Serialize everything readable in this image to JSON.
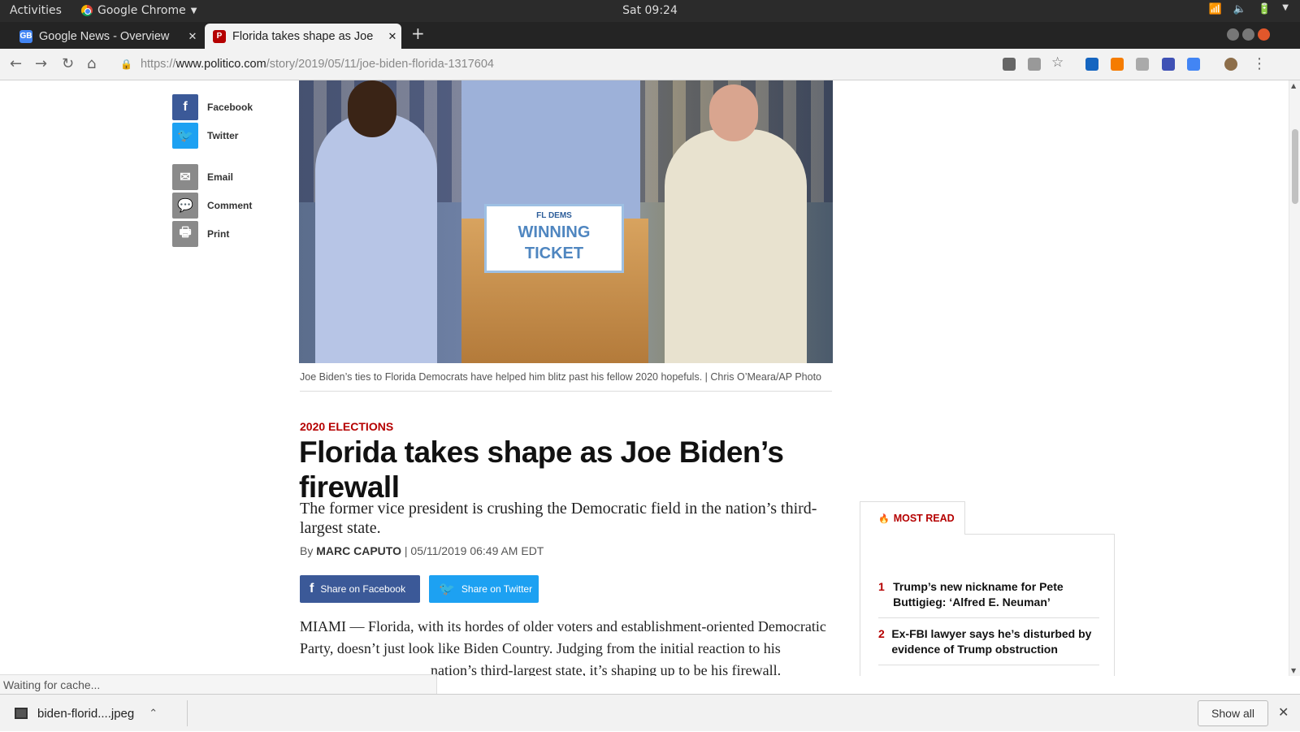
{
  "system_bar": {
    "activities": "Activities",
    "app_name": "Google Chrome",
    "clock": "Sat 09:24"
  },
  "tabs": [
    {
      "title": "Google News - Overview",
      "favicon_text": "GB",
      "favicon_color": "#4285f4"
    },
    {
      "title": "Florida takes shape as Joe",
      "favicon_text": "P",
      "favicon_color": "#b50000"
    }
  ],
  "address_bar": {
    "scheme": "https://",
    "host": "www.politico.com",
    "path": "/story/2019/05/11/joe-biden-florida-1317604"
  },
  "share_rail": [
    {
      "label": "Facebook",
      "icon": "facebook-icon",
      "color": "#3b5998"
    },
    {
      "label": "Twitter",
      "icon": "twitter-icon",
      "color": "#1da1f2"
    },
    {
      "label": "Email",
      "icon": "email-icon",
      "color": "#8a8a8a"
    },
    {
      "label": "Comment",
      "icon": "comment-icon",
      "color": "#8a8a8a"
    },
    {
      "label": "Print",
      "icon": "print-icon",
      "color": "#8a8a8a"
    }
  ],
  "hero": {
    "sign_line1": "FL DEMS",
    "sign_line2": "WINNING",
    "sign_line3": "TICKET"
  },
  "article": {
    "caption": "Joe Biden’s ties to Florida Democrats have helped him blitz past his fellow 2020 hopefuls. | Chris O’Meara/AP Photo",
    "kicker": "2020 ELECTIONS",
    "headline": "Florida takes shape as Joe Biden’s firewall",
    "dek": "The former vice president is crushing the Democratic field in the nation’s third-largest state.",
    "byline_prefix": "By",
    "author": "MARC CAPUTO",
    "date": "| 05/11/2019 06:49 AM EDT",
    "share_facebook": "Share on Facebook",
    "share_twitter": "Share on Twitter",
    "body_line1": "MIAMI — Florida, with its hordes of older voters and establishment-oriented Democratic",
    "body_line2": "Party, doesn’t just look like Biden Country. Judging from the initial reaction to his",
    "body_line3": "nation’s third-largest state, it’s shaping up to be his firewall."
  },
  "most_read": {
    "heading": "MOST READ",
    "items": [
      {
        "num": "1",
        "title": "Trump’s new nickname for Pete Buttigieg: ‘Alfred E. Neuman’"
      },
      {
        "num": "2",
        "title": "Ex-FBI lawyer says he’s disturbed by evidence of Trump obstruction"
      }
    ]
  },
  "status_text": "Waiting for cache...",
  "download_bar": {
    "file": "biden-florid....jpeg",
    "show_all": "Show all"
  },
  "colors": {
    "politico_red": "#b50000",
    "facebook": "#3b5998",
    "twitter": "#1da1f2"
  }
}
